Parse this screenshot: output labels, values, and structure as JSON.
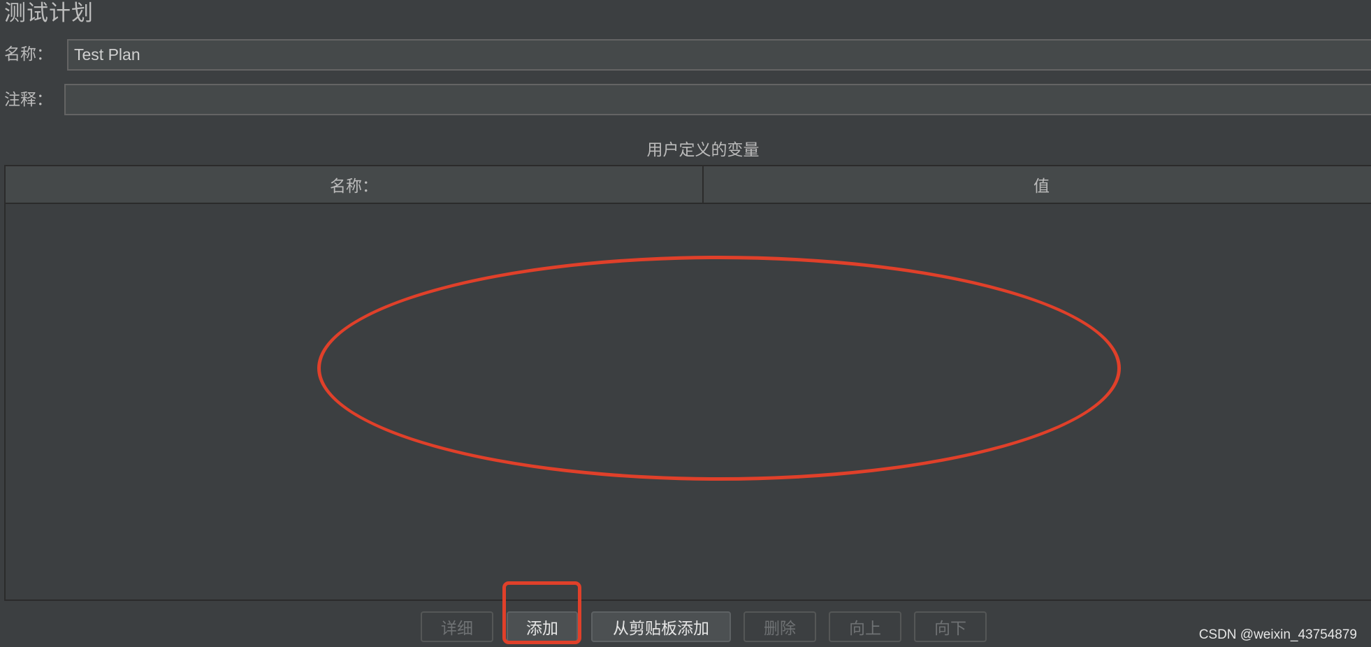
{
  "page": {
    "title": "测试计划"
  },
  "form": {
    "name_label": "名称：",
    "name_value": "Test Plan",
    "comment_label": "注释：",
    "comment_value": ""
  },
  "variables": {
    "section_title": "用户定义的变量",
    "columns": [
      "名称：",
      "值"
    ],
    "rows": []
  },
  "buttons": {
    "detail": "详细",
    "add": "添加",
    "add_from_clipboard": "从剪贴板添加",
    "delete": "删除",
    "move_up": "向上",
    "move_down": "向下"
  },
  "annotations": {
    "color": "#e0402a"
  },
  "watermark": "CSDN @weixin_43754879"
}
